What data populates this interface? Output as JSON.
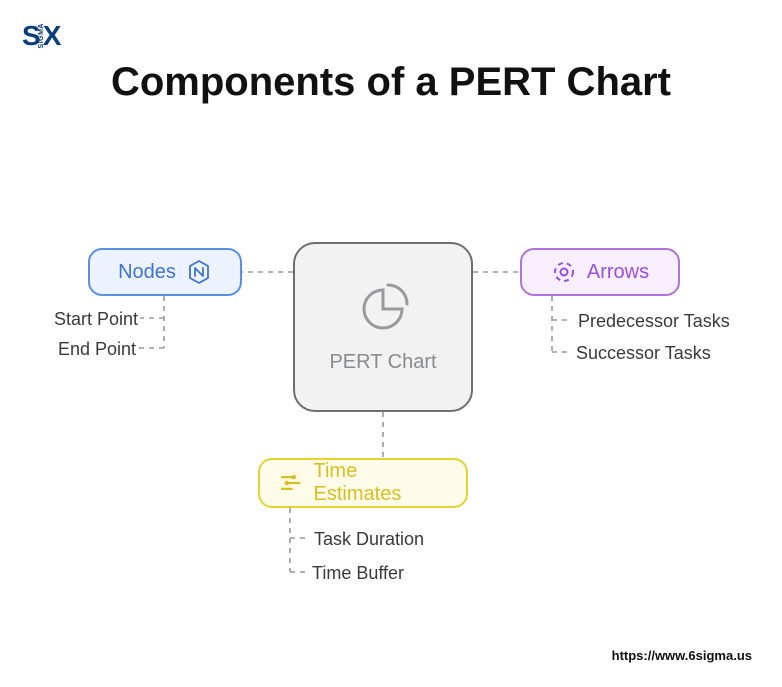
{
  "logo": {
    "left": "S",
    "vertical": "SIGMA",
    "right": "X"
  },
  "title": "Components of a PERT Chart",
  "center": {
    "label": "PERT Chart"
  },
  "branches": {
    "nodes": {
      "label": "Nodes",
      "items": [
        "Start Point",
        "End Point"
      ]
    },
    "arrows": {
      "label": "Arrows",
      "items": [
        "Predecessor Tasks",
        "Successor Tasks"
      ]
    },
    "time": {
      "label": "Time Estimates",
      "items": [
        "Task Duration",
        "Time Buffer"
      ]
    }
  },
  "footer": {
    "url": "https://www.6sigma.us"
  }
}
